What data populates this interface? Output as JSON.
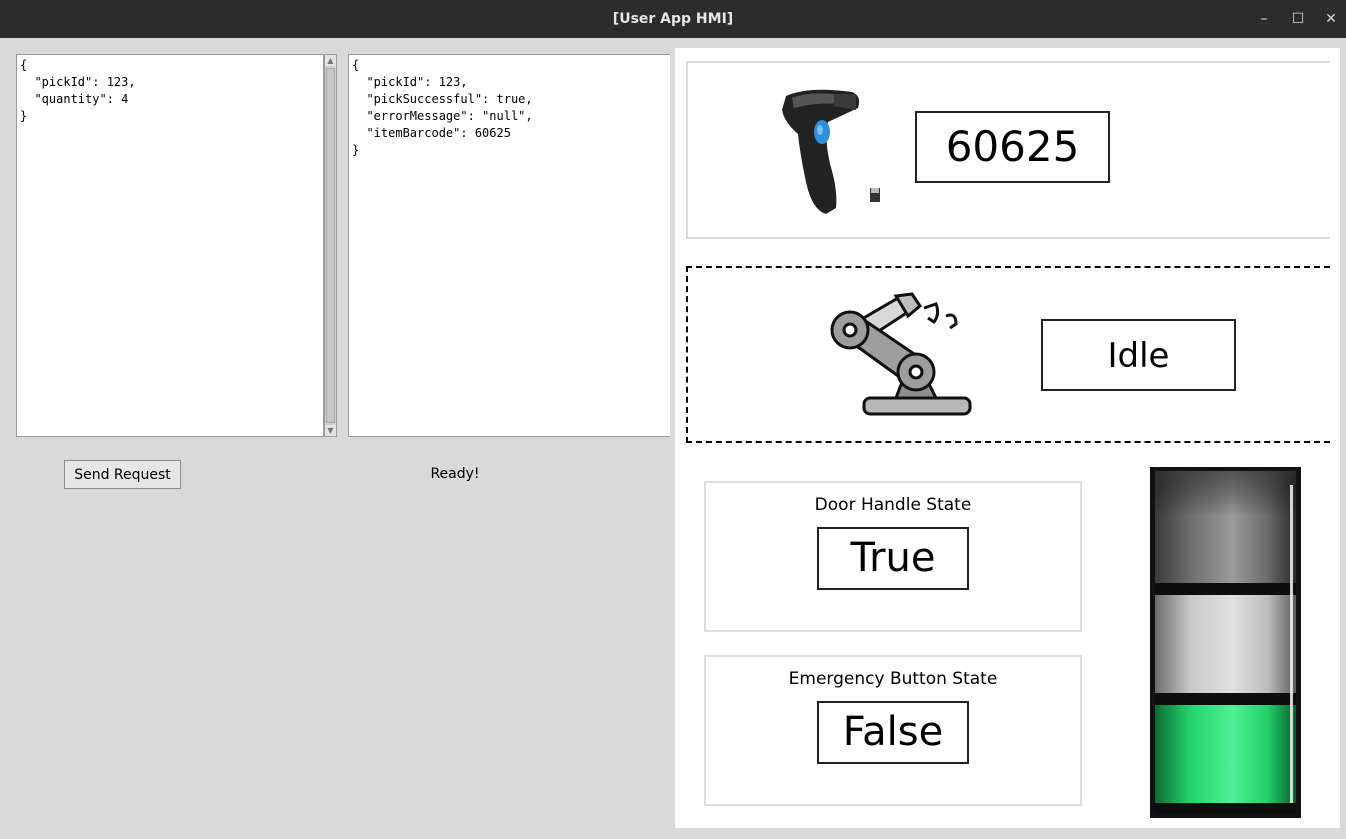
{
  "window": {
    "title": "[User App HMI]",
    "controls": {
      "minimize": "–",
      "maximize": "☐",
      "close": "✕"
    }
  },
  "request_text": "{\n  \"pickId\": 123,\n  \"quantity\": 4\n}",
  "response_text": "{\n  \"pickId\": 123,\n  \"pickSuccessful\": true,\n  \"errorMessage\": \"null\",\n  \"itemBarcode\": 60625\n}",
  "send_button_label": "Send Request",
  "status_text": "Ready!",
  "scanner": {
    "icon": "barcode-scanner-icon",
    "barcode_value": "60625"
  },
  "robot": {
    "icon": "robot-arm-icon",
    "state": "Idle"
  },
  "door_handle": {
    "label": "Door Handle State",
    "value": "True"
  },
  "emergency_button": {
    "label": "Emergency Button State",
    "value": "False"
  },
  "signal_tower": {
    "segments": [
      "off",
      "off",
      "on"
    ],
    "active_segment": "bottom",
    "active_color": "#2de37a"
  }
}
